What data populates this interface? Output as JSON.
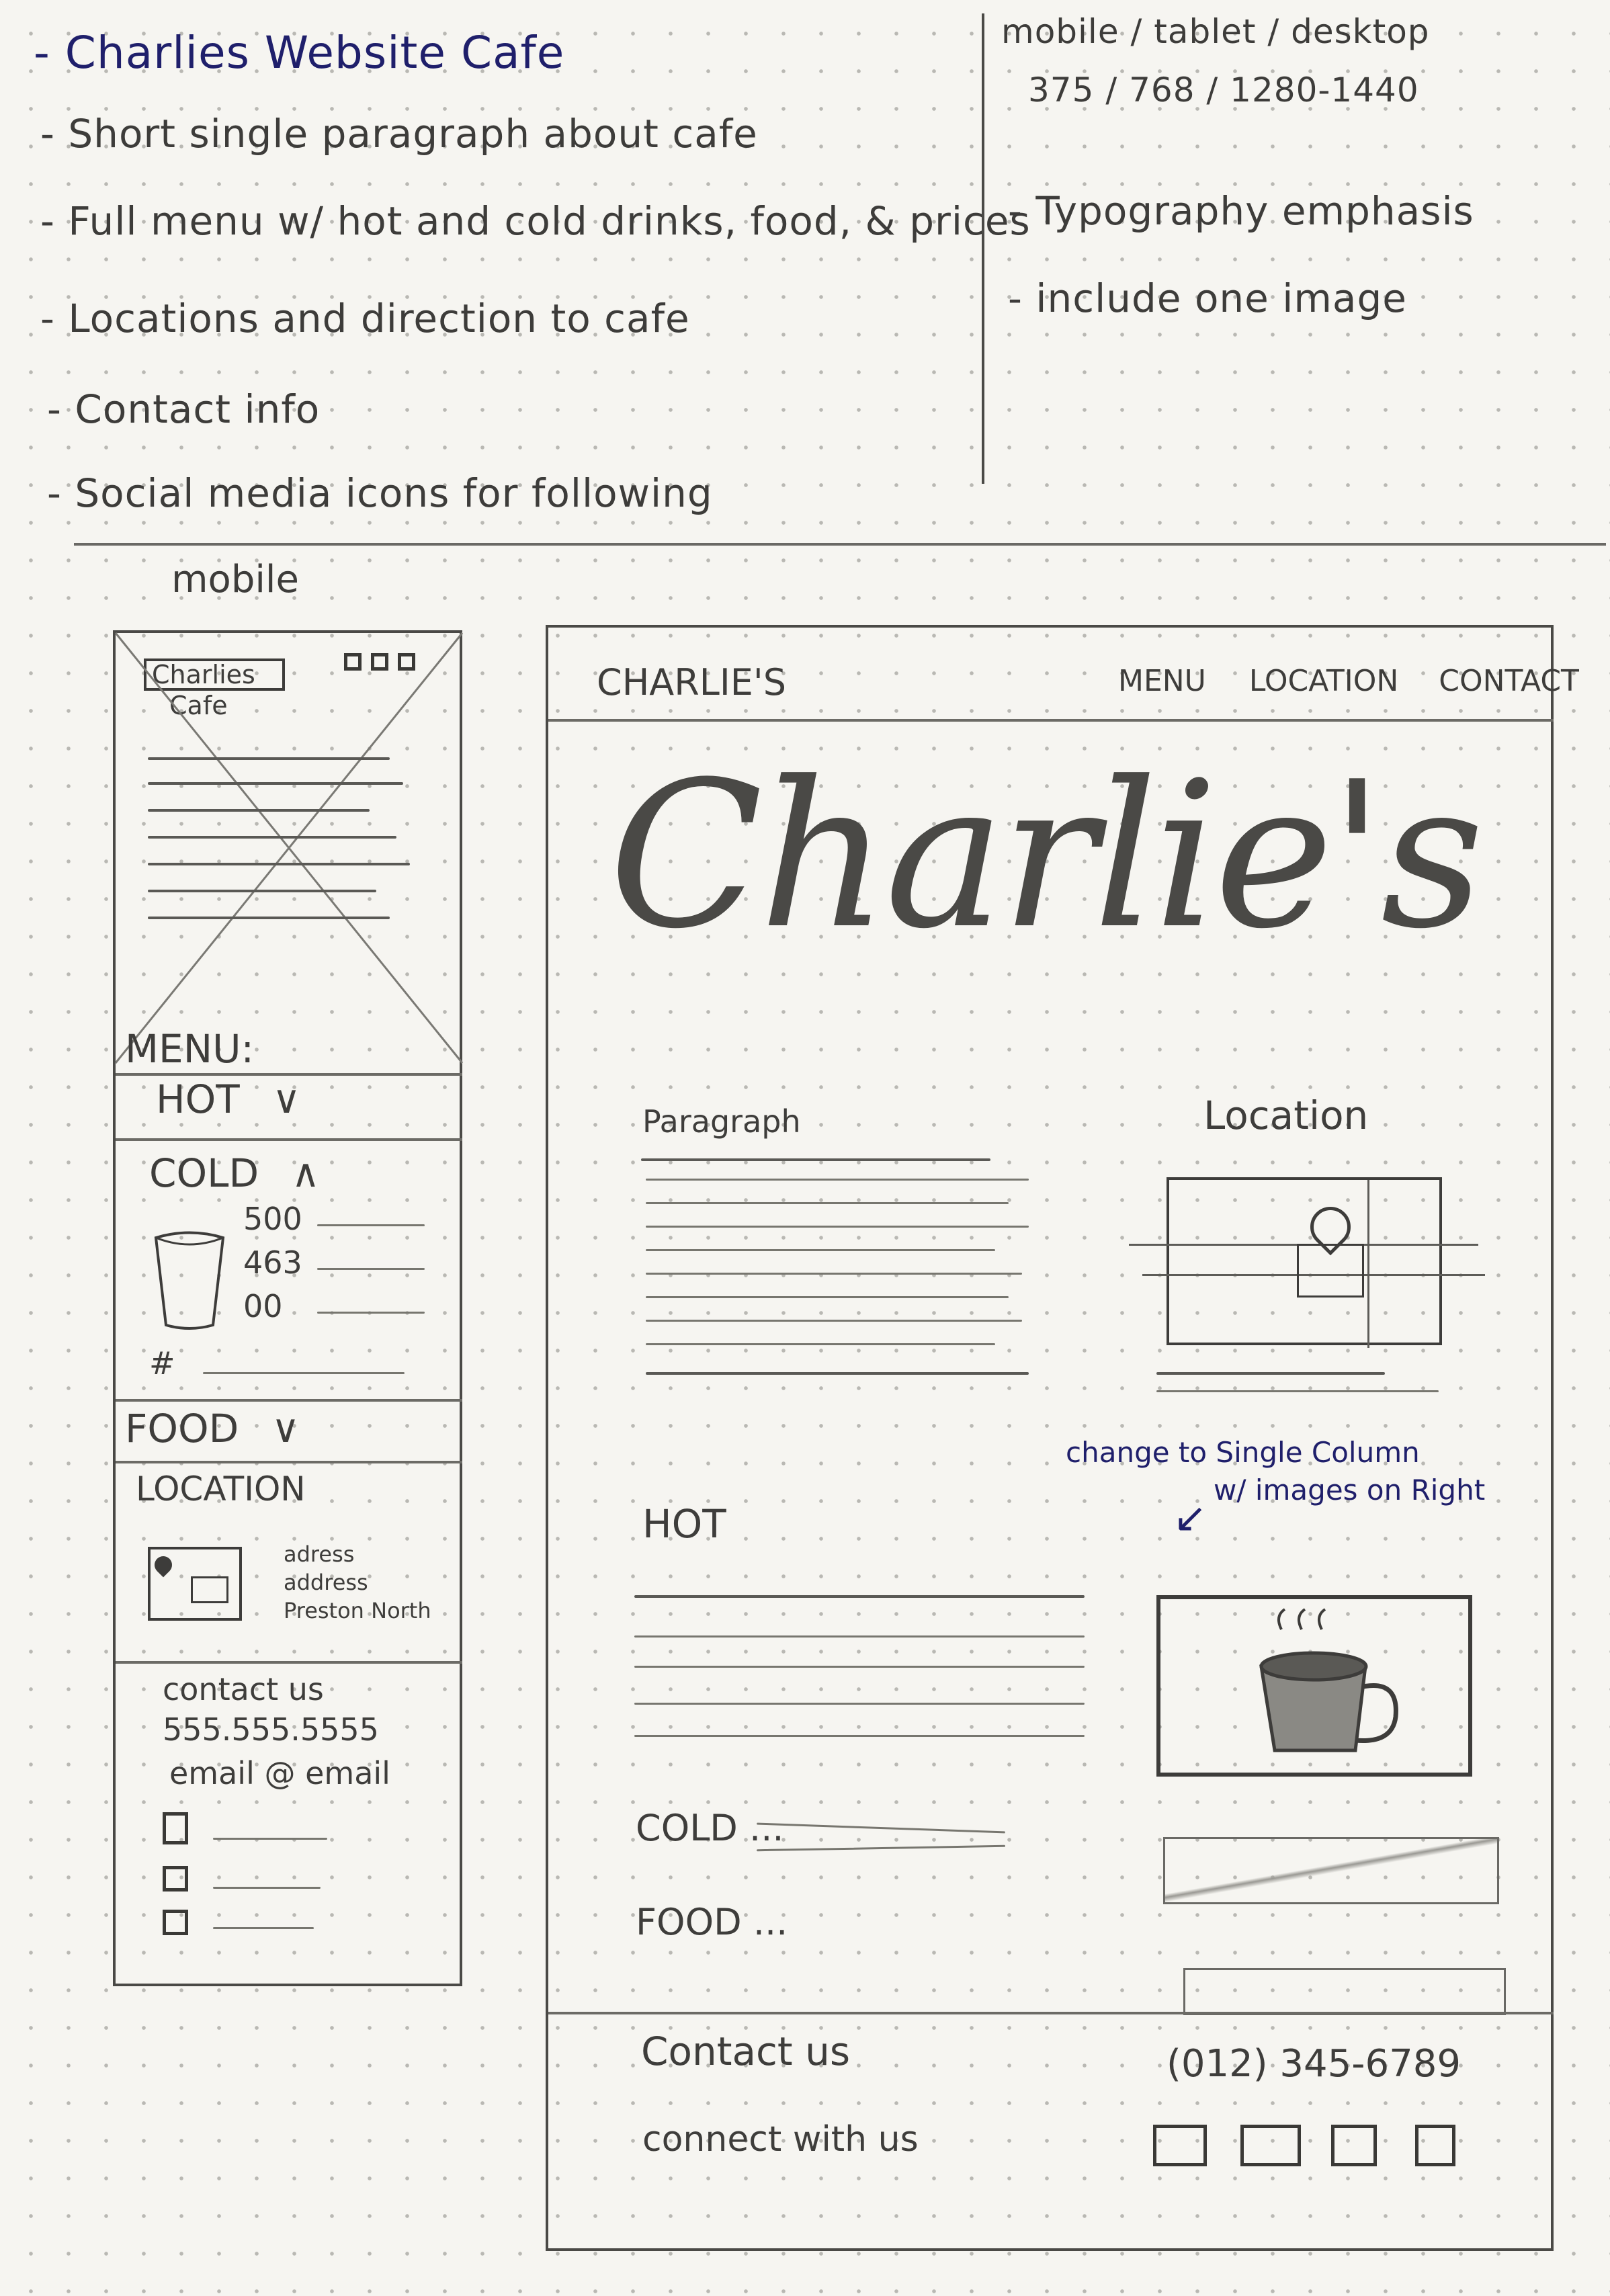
{
  "notes": {
    "left": [
      "- Charlies Website   Cafe",
      "- Short single paragraph about cafe",
      "- Full menu w/ hot and cold drinks, food, & prices",
      "- Locations and direction to cafe",
      "- Contact info",
      "- Social media icons for following"
    ],
    "right": [
      "mobile / tablet / desktop",
      "375 / 768 / 1280-1440",
      "- Typography emphasis",
      "- include one image"
    ]
  },
  "mobile": {
    "heading": "mobile",
    "logo_line1": "Charlies",
    "logo_line2": "Cafe",
    "menu_heading": "MENU:",
    "hot": "HOT",
    "cold": "COLD",
    "sizes": [
      "500",
      "463",
      "00"
    ],
    "hash": "#",
    "food": "FOOD",
    "location": "LOCATION",
    "address": [
      "adress",
      "address",
      "Preston North"
    ],
    "contact_heading": "contact us",
    "phone": "555.555.5555",
    "email": "email @ email",
    "icons": [
      "social-icon-1",
      "social-icon-2",
      "social-icon-3"
    ]
  },
  "desktop": {
    "brand": "CHARLIE'S",
    "nav": [
      "MENU",
      "LOCATION",
      "CONTACT"
    ],
    "hero": "Charlie's",
    "paragraph_label": "Paragraph",
    "location_label": "Location",
    "annotation_line1": "change to Single Column",
    "annotation_line2": "w/ images on Right",
    "hot": "HOT",
    "cold": "COLD ...",
    "food": "FOOD ...",
    "contact_heading": "Contact us",
    "phone": "(012) 345-6789",
    "connect": "connect with us",
    "social_icons": [
      "social-icon-1",
      "social-icon-2",
      "social-icon-3",
      "social-icon-4"
    ]
  },
  "colors": {
    "pencil": "#3d3c3a",
    "ink": "#1f1f6b",
    "paper": "#f6f5f1"
  }
}
